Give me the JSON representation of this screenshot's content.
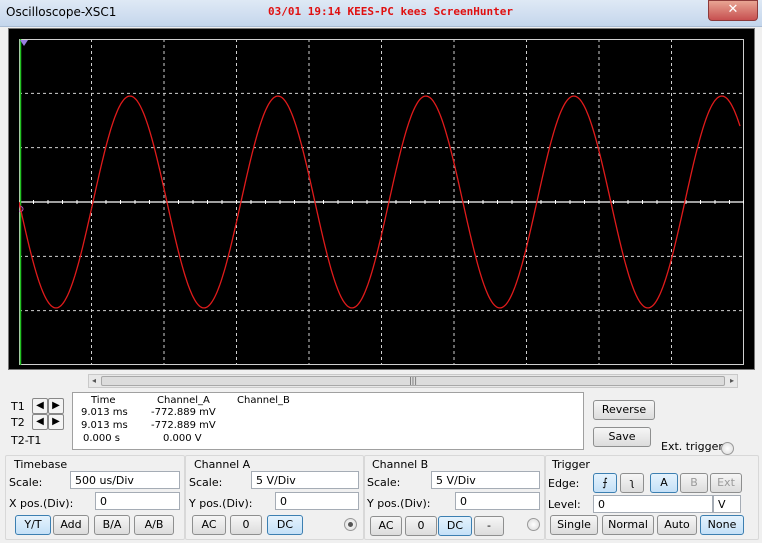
{
  "window": {
    "title": "Oscilloscope-XSC1",
    "close_glyph": "✕"
  },
  "overlay": {
    "text": "03/01 19:14 KEES-PC kees ScreenHunter"
  },
  "screen": {
    "colors": {
      "background": "#000000",
      "grid": "#cfcfcf",
      "trace": "#e01b1b",
      "baseline": "#ffffff",
      "cursor": "#22c122"
    },
    "waveform": {
      "cycles": 4.9,
      "amplitude_div": 1.95,
      "phase": "starts at zero, going negative"
    }
  },
  "scrollbar": {
    "grip": "|||",
    "left_arrow": "◂",
    "right_arrow": "▸"
  },
  "measurements": {
    "headers": [
      "Time",
      "Channel_A",
      "Channel_B"
    ],
    "rows": [
      {
        "label": "T1",
        "time": "9.013 ms",
        "channel_a": "-772.889 mV",
        "channel_b": ""
      },
      {
        "label": "T2",
        "time": "9.013 ms",
        "channel_a": "-772.889 mV",
        "channel_b": ""
      },
      {
        "label": "T2-T1",
        "time": "0.000 s",
        "channel_a": "0.000 V",
        "channel_b": ""
      }
    ],
    "arrow_left": "◀",
    "arrow_right": "▶"
  },
  "actions": {
    "reverse": "Reverse",
    "save": "Save",
    "ext_trigger": "Ext. trigger"
  },
  "timebase": {
    "title": "Timebase",
    "scale_label": "Scale:",
    "scale_value": "500 us/Div",
    "xpos_label": "X pos.(Div):",
    "xpos_value": "0",
    "buttons": [
      "Y/T",
      "Add",
      "B/A",
      "A/B"
    ]
  },
  "channel_a": {
    "title": "Channel A",
    "scale_label": "Scale:",
    "scale_value": "5  V/Div",
    "ypos_label": "Y pos.(Div):",
    "ypos_value": "0",
    "buttons": [
      "AC",
      "0",
      "DC"
    ]
  },
  "channel_b": {
    "title": "Channel B",
    "scale_label": "Scale:",
    "scale_value": "5  V/Div",
    "ypos_label": "Y pos.(Div):",
    "ypos_value": "0",
    "buttons": [
      "AC",
      "0",
      "DC",
      "-"
    ]
  },
  "trigger": {
    "title": "Trigger",
    "edge_label": "Edge:",
    "edge_rising": "⨍",
    "edge_falling": "ʅ",
    "sources": [
      "A",
      "B",
      "Ext"
    ],
    "level_label": "Level:",
    "level_value": "0",
    "level_unit": "V",
    "modes": [
      "Single",
      "Normal",
      "Auto",
      "None"
    ]
  }
}
